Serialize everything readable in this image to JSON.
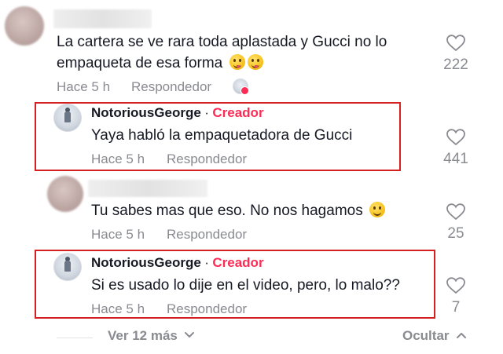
{
  "comments": [
    {
      "text_line1": "La cartera se ve rara toda aplastada y Gucci no lo",
      "text_line2": "empaqueta de esa forma",
      "time": "Hace 5 h",
      "reply": "Respondedor",
      "likes": "222"
    },
    {
      "username": "NotoriousGeorge",
      "separator": "·",
      "creator_badge": "Creador",
      "text": "Yaya habló la empaquetadora de Gucci",
      "time": "Hace 5 h",
      "reply": "Respondedor",
      "likes": "441"
    },
    {
      "text": "Tu sabes mas que eso. No nos hagamos",
      "time": "Hace 5 h",
      "reply": "Respondedor",
      "likes": "25"
    },
    {
      "username": "NotoriousGeorge",
      "separator": "·",
      "creator_badge": "Creador",
      "text": "Si es usado lo dije en el video, pero, lo malo??",
      "time": "Hace 5 h",
      "reply": "Respondedor",
      "likes": "7"
    }
  ],
  "footer": {
    "view_more": "Ver 12 más",
    "hide": "Ocultar"
  },
  "colors": {
    "creator": "#fe2c55",
    "highlight_box": "#d62020",
    "muted_text": "#8a8b91"
  }
}
